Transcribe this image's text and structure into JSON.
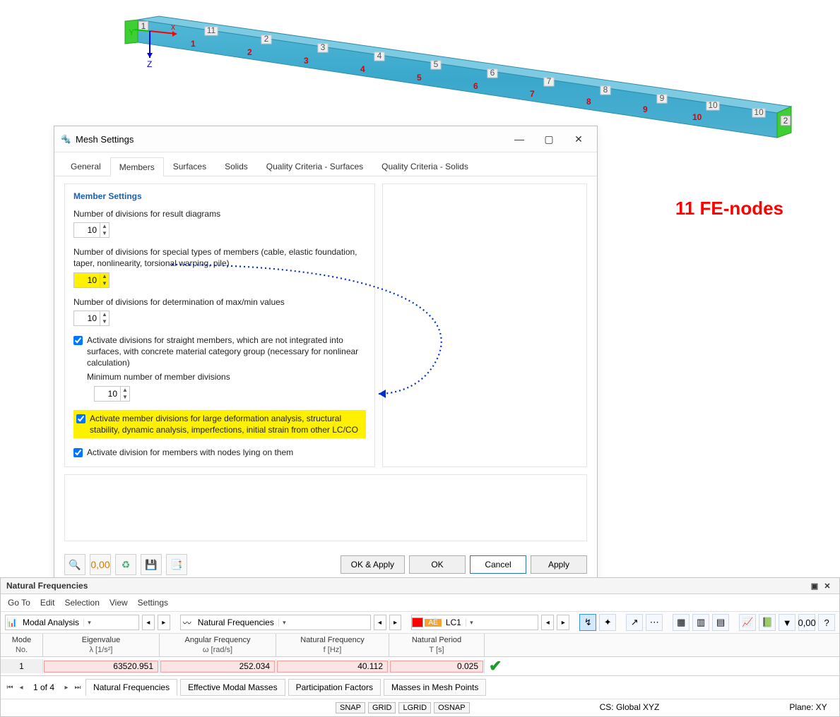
{
  "annotation": "11 FE-nodes",
  "beam": {
    "axis": {
      "x": "x",
      "y": "Y",
      "z": "Z"
    },
    "node_labels_red": [
      "1",
      "2",
      "3",
      "4",
      "5",
      "6",
      "7",
      "8",
      "9",
      "10"
    ],
    "node_labels_grey": [
      "11",
      "2",
      "3",
      "4",
      "5",
      "6",
      "7",
      "8",
      "9",
      "10",
      "10"
    ],
    "end_left": "1",
    "end_right": "2"
  },
  "dialog": {
    "title": "Mesh Settings",
    "tabs": [
      "General",
      "Members",
      "Surfaces",
      "Solids",
      "Quality Criteria - Surfaces",
      "Quality Criteria - Solids"
    ],
    "active_tab": "Members",
    "section_title": "Member Settings",
    "r1_label": "Number of divisions for result diagrams",
    "r1_value": "10",
    "r2_label": "Number of divisions for special types of members (cable, elastic foundation, taper, nonlinearity, torsional warping, pile)",
    "r2_value": "10",
    "r3_label": "Number of divisions for determination of max/min values",
    "r3_value": "10",
    "c1_label": "Activate divisions for straight members, which are not integrated into surfaces, with concrete material category group (necessary for nonlinear calculation)",
    "c1_sub": "Minimum number of member divisions",
    "c1_value": "10",
    "c2_label": "Activate member divisions for large deformation analysis, structural stability, dynamic analysis, imperfections, initial strain from other LC/CO",
    "c3_label": "Activate division for members with nodes lying on them",
    "buttons": {
      "ok_apply": "OK & Apply",
      "ok": "OK",
      "cancel": "Cancel",
      "apply": "Apply"
    }
  },
  "panel": {
    "title": "Natural Frequencies",
    "menu": [
      "Go To",
      "Edit",
      "Selection",
      "View",
      "Settings"
    ],
    "combo1": "Modal Analysis",
    "combo2": "Natural Frequencies",
    "combo3_tag": "AE",
    "combo3": "LC1",
    "headers": [
      {
        "a": "Mode",
        "b": "No."
      },
      {
        "a": "Eigenvalue",
        "b": "λ [1/s²]"
      },
      {
        "a": "Angular Frequency",
        "b": "ω [rad/s]"
      },
      {
        "a": "Natural Frequency",
        "b": "f [Hz]"
      },
      {
        "a": "Natural Period",
        "b": "T [s]"
      }
    ],
    "row": {
      "no": "1",
      "eig": "63520.951",
      "ang": "252.034",
      "freq": "40.112",
      "per": "0.025"
    },
    "pager": "1 of 4",
    "tabs2": [
      "Natural Frequencies",
      "Effective Modal Masses",
      "Participation Factors",
      "Masses in Mesh Points"
    ],
    "status": {
      "snap": [
        "SNAP",
        "GRID",
        "LGRID",
        "OSNAP"
      ],
      "cs": "CS: Global XYZ",
      "plane": "Plane: XY"
    }
  }
}
